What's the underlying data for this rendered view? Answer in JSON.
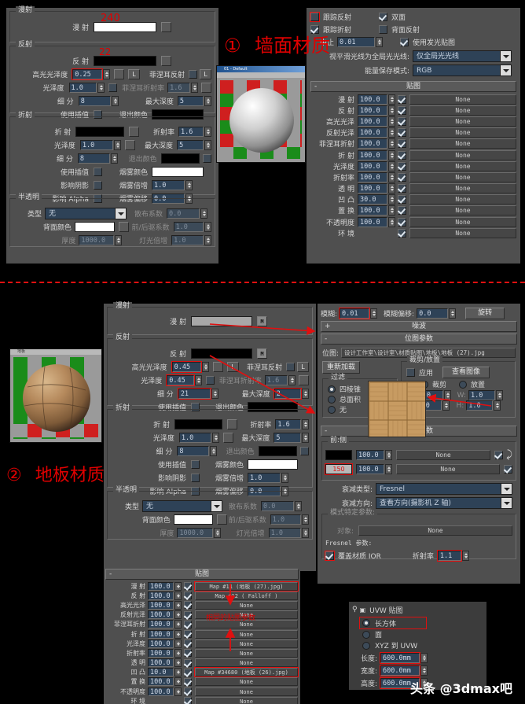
{
  "meta": {
    "watermark": "头条 @3dmax吧"
  },
  "annotations": {
    "wall": {
      "num": "①",
      "text": "墙面材质"
    },
    "floor": {
      "num": "②",
      "text": "地板材质"
    },
    "maps_note": "相同的贴图参数"
  },
  "wall": {
    "diffuse_group": {
      "title": "漫射",
      "label": "漫 射",
      "value": "240"
    },
    "reflect_group": {
      "title": "反射",
      "reflect_label": "反 射",
      "reflect_value": "22",
      "rows": [
        {
          "label": "高光光泽度",
          "value": "0.25",
          "highlight": true
        },
        {
          "label": "光泽度",
          "value": "1.0"
        },
        {
          "label": "细  分",
          "value": "8"
        }
      ],
      "interp_label": "使用插值",
      "fresnel_label": "菲涅耳反射",
      "fresnel_ior_label": "菲涅耳折射率",
      "fresnel_ior_value": "1.6",
      "maxdepth_label": "最大深度",
      "maxdepth_value": "5",
      "exit_label": "退出颜色",
      "l_btn": "L"
    },
    "refract_group": {
      "title": "折射",
      "refract_label": "折 射",
      "rows": [
        {
          "label": "光泽度",
          "value": "1.0"
        },
        {
          "label": "细  分",
          "value": "8"
        }
      ],
      "interp_label": "使用插值",
      "shadow_label": "影响阴影",
      "alpha_label": "影响 Alpha",
      "ior_label": "折射率",
      "ior_value": "1.6",
      "maxdepth_label": "最大深度",
      "maxdepth_value": "5",
      "exit_label": "退出颜色",
      "fog_color_label": "烟雾颜色",
      "fog_mult_label": "烟雾倍增",
      "fog_mult_value": "1.0",
      "fog_bias_label": "烟雾偏移",
      "fog_bias_value": "0.0"
    },
    "translucent_group": {
      "title": "半透明",
      "type_label": "类型",
      "type_value": "无",
      "back_color_label": "背面颜色",
      "thickness_label": "厚度",
      "thickness_value": "1000.0",
      "scatter_label": "散布系数",
      "scatter_value": "0.0",
      "fwdback_label": "前/后驱系数",
      "fwdback_value": "1.0",
      "light_mult_label": "灯光倍增",
      "light_mult_value": "1.0"
    },
    "options": {
      "trace_reflect": "跟踪反射",
      "trace_refract": "跟踪折射",
      "cutoff_label": "中止",
      "cutoff_value": "0.01",
      "double_sided": "双面",
      "back_reflect": "背面反射",
      "use_glossy_map": "使用发光贴图",
      "smooth_label": "视平滑光线为全局光光线:",
      "smooth_value": "仅全局光光线",
      "energy_label": "能量保存模式:",
      "energy_value": "RGB"
    },
    "maps": {
      "title": "贴图",
      "none": "None",
      "rows": [
        {
          "label": "漫 射",
          "amount": "100.0",
          "on": true,
          "slot": "None"
        },
        {
          "label": "反 射",
          "amount": "100.0",
          "on": true,
          "slot": "None"
        },
        {
          "label": "高光光泽",
          "amount": "100.0",
          "on": true,
          "slot": "None"
        },
        {
          "label": "反射光泽",
          "amount": "100.0",
          "on": true,
          "slot": "None"
        },
        {
          "label": "菲涅耳折射",
          "amount": "100.0",
          "on": true,
          "slot": "None"
        },
        {
          "label": "折 射",
          "amount": "100.0",
          "on": true,
          "slot": "None"
        },
        {
          "label": "光泽度",
          "amount": "100.0",
          "on": true,
          "slot": "None"
        },
        {
          "label": "折射率",
          "amount": "100.0",
          "on": true,
          "slot": "None"
        },
        {
          "label": "透 明",
          "amount": "100.0",
          "on": true,
          "slot": "None"
        },
        {
          "label": "凹 凸",
          "amount": "30.0",
          "on": true,
          "slot": "None"
        },
        {
          "label": "置 换",
          "amount": "100.0",
          "on": true,
          "slot": "None"
        },
        {
          "label": "不透明度",
          "amount": "100.0",
          "on": true,
          "slot": "None"
        },
        {
          "label": "环 境",
          "amount": "",
          "on": true,
          "slot": "None"
        }
      ]
    },
    "preview_title": "01 - Default"
  },
  "floor": {
    "preview_title": "地板",
    "diffuse_group": {
      "title": "漫射",
      "label": "漫 射",
      "m_btn": "M"
    },
    "reflect_group": {
      "title": "反射",
      "reflect_label": "反 射",
      "m_btn": "M",
      "rows": [
        {
          "label": "高光光泽度",
          "value": "0.45",
          "highlight": true
        },
        {
          "label": "光泽度",
          "value": "0.45",
          "highlight": true
        },
        {
          "label": "细  分",
          "value": "21",
          "highlight": true
        }
      ],
      "interp_label": "使用插值",
      "fresnel_label": "菲涅耳反射",
      "fresnel_ior_label": "菲涅耳折射率",
      "fresnel_ior_value": "1.6",
      "maxdepth_label": "最大深度",
      "maxdepth_value": "2",
      "exit_label": "退出颜色",
      "l_btn": "L"
    },
    "refract_group": {
      "title": "折射",
      "refract_label": "折 射",
      "rows": [
        {
          "label": "光泽度",
          "value": "1.0"
        },
        {
          "label": "细  分",
          "value": "8"
        }
      ],
      "interp_label": "使用插值",
      "shadow_label": "影响阴影",
      "alpha_label": "影响 Alpha",
      "ior_label": "折射率",
      "ior_value": "1.6",
      "maxdepth_label": "最大深度",
      "maxdepth_value": "5",
      "exit_label": "退出颜色",
      "fog_color_label": "烟雾颜色",
      "fog_mult_label": "烟雾倍增",
      "fog_mult_value": "1.0",
      "fog_bias_label": "烟雾偏移",
      "fog_bias_value": "0.0"
    },
    "translucent_group": {
      "title": "半透明",
      "type_label": "类型",
      "type_value": "无",
      "back_color_label": "背面颜色",
      "thickness_label": "厚度",
      "thickness_value": "1000.0",
      "scatter_label": "散布系数",
      "scatter_value": "0.0",
      "fwdback_label": "前/后驱系数",
      "fwdback_value": "1.0",
      "light_mult_label": "灯光倍增",
      "light_mult_value": "1.0"
    },
    "maps": {
      "title": "贴图",
      "rows": [
        {
          "label": "漫 射",
          "amount": "100.0",
          "on": true,
          "slot": "Map #11  (地板 (27).jpg)",
          "highlight": true
        },
        {
          "label": "反 射",
          "amount": "100.0",
          "on": true,
          "slot": "Map #12   ( Falloff )"
        },
        {
          "label": "高光光泽",
          "amount": "100.0",
          "on": true,
          "slot": "None"
        },
        {
          "label": "反射光泽",
          "amount": "100.0",
          "on": true,
          "slot": "None"
        },
        {
          "label": "菲涅耳折射",
          "amount": "100.0",
          "on": true,
          "slot": "None"
        },
        {
          "label": "折 射",
          "amount": "100.0",
          "on": true,
          "slot": "None"
        },
        {
          "label": "光泽度",
          "amount": "100.0",
          "on": true,
          "slot": "None"
        },
        {
          "label": "折射率",
          "amount": "100.0",
          "on": true,
          "slot": "None"
        },
        {
          "label": "透 明",
          "amount": "100.0",
          "on": true,
          "slot": "None"
        },
        {
          "label": "凹 凸",
          "amount": "10.0",
          "on": true,
          "slot": "Map #34680 (地板 (26).jpg)",
          "highlight": true
        },
        {
          "label": "置 换",
          "amount": "100.0",
          "on": true,
          "slot": "None"
        },
        {
          "label": "不透明度",
          "amount": "100.0",
          "on": true,
          "slot": "None"
        },
        {
          "label": "环 境",
          "amount": "",
          "on": true,
          "slot": "None"
        }
      ]
    }
  },
  "bitmap": {
    "coords": {
      "blur_label": "模糊:",
      "blur_value": "0.01",
      "blur_offset_label": "模糊偏移:",
      "blur_offset_value": "0.0",
      "rotate_btn": "旋转"
    },
    "noise_rollup": "噪波",
    "params_rollup": "位图参数",
    "bitmap_label": "位图:",
    "bitmap_path": "设计工作室\\设计室\\材质贴图\\地板\\地板 (27).jpg",
    "reload_btn": "重新加载",
    "crop_place_label": "裁剪/放置",
    "apply_label": "应用",
    "view_image_btn": "查看图像",
    "filter_group": "过滤",
    "filter_options": [
      "四棱锥",
      "总面积",
      "无"
    ],
    "crop_radio": "裁剪",
    "place_radio": "放置",
    "u_label": "U:",
    "u_value": "0.0",
    "v_label": "V:",
    "v_value": "0.0",
    "w_label": "W:",
    "w_value": "1.0",
    "h_label": "H:",
    "h_value": "1.0"
  },
  "falloff": {
    "rollup": "衰减参数",
    "group": "前:侧",
    "none": "None",
    "front_amount": "100.0",
    "side_amount": "100.0",
    "side_color_value": "150",
    "type_label": "衰减类型:",
    "type_value": "Fresnel",
    "direction_label": "衰减方向:",
    "direction_value": "查看方向(摄影机 Z 轴)",
    "mode_group": "模式特定参数:",
    "object_label": "对象:",
    "object_value": "None",
    "fresnel_params_label": "Fresnel 参数:",
    "override_ior_label": "覆盖材质 IOR",
    "ior_label": "折射率",
    "ior_value": "1.1"
  },
  "uvw": {
    "title": "UVW 贴图",
    "options": [
      "长方体",
      "面",
      "XYZ 到 UVW"
    ],
    "selected": "长方体",
    "length_label": "长度:",
    "length_value": "600.0mm",
    "width_label": "宽度:",
    "width_value": "600.0mm",
    "height_label": "高度:",
    "height_value": "600.0mm"
  }
}
